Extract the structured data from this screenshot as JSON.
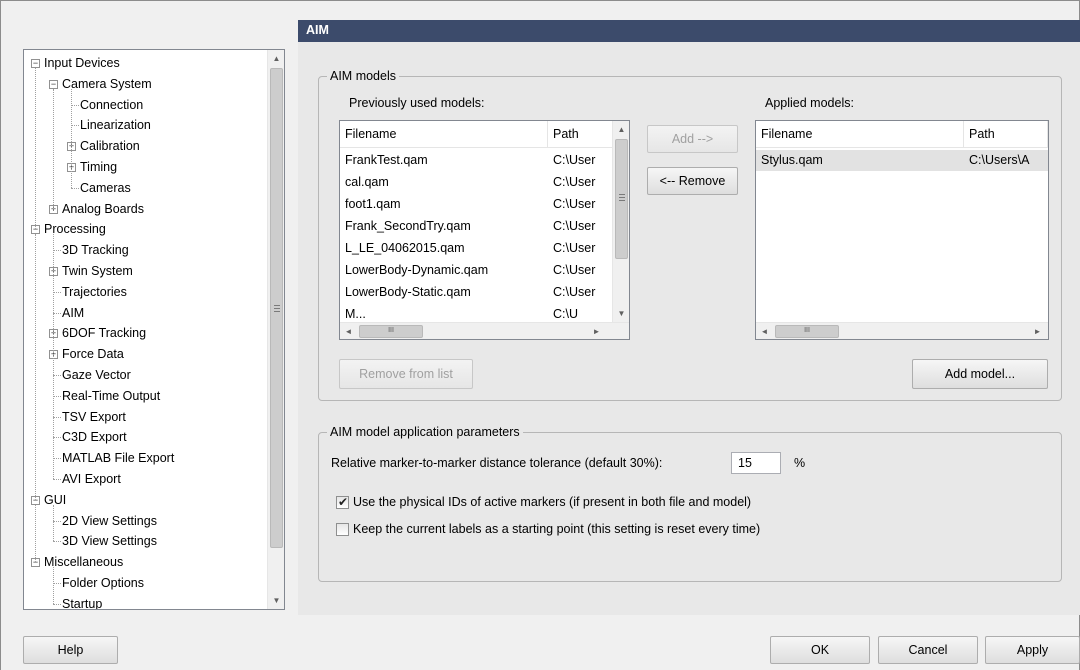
{
  "tree": {
    "items": [
      {
        "label": "Input Devices",
        "exp": "−"
      },
      {
        "label": "Camera System",
        "exp": "−"
      },
      {
        "label": "Connection",
        "exp": ""
      },
      {
        "label": "Linearization",
        "exp": ""
      },
      {
        "label": "Calibration",
        "exp": "+"
      },
      {
        "label": "Timing",
        "exp": "+"
      },
      {
        "label": "Cameras",
        "exp": ""
      },
      {
        "label": "Analog Boards",
        "exp": "+"
      },
      {
        "label": "Processing",
        "exp": "−"
      },
      {
        "label": "3D Tracking",
        "exp": ""
      },
      {
        "label": "Twin System",
        "exp": "+"
      },
      {
        "label": "Trajectories",
        "exp": ""
      },
      {
        "label": "AIM",
        "exp": ""
      },
      {
        "label": "6DOF Tracking",
        "exp": "+"
      },
      {
        "label": "Force Data",
        "exp": "+"
      },
      {
        "label": "Gaze Vector",
        "exp": ""
      },
      {
        "label": "Real-Time Output",
        "exp": ""
      },
      {
        "label": "TSV Export",
        "exp": ""
      },
      {
        "label": "C3D Export",
        "exp": ""
      },
      {
        "label": "MATLAB File Export",
        "exp": ""
      },
      {
        "label": "AVI Export",
        "exp": ""
      },
      {
        "label": "GUI",
        "exp": "−"
      },
      {
        "label": "2D View Settings",
        "exp": ""
      },
      {
        "label": "3D View Settings",
        "exp": ""
      },
      {
        "label": "Miscellaneous",
        "exp": "−"
      },
      {
        "label": "Folder Options",
        "exp": ""
      },
      {
        "label": "Startup",
        "exp": ""
      }
    ]
  },
  "page": {
    "title": "AIM"
  },
  "aim_models": {
    "group_title": "AIM models",
    "previous_label": "Previously used models:",
    "applied_label": "Applied models:",
    "col_filename": "Filename",
    "col_path": "Path",
    "previous_rows": [
      {
        "filename": "FrankTest.qam",
        "path": "C:\\User"
      },
      {
        "filename": "cal.qam",
        "path": "C:\\User"
      },
      {
        "filename": "foot1.qam",
        "path": "C:\\User"
      },
      {
        "filename": "Frank_SecondTry.qam",
        "path": "C:\\User"
      },
      {
        "filename": "L_LE_04062015.qam",
        "path": "C:\\User"
      },
      {
        "filename": "LowerBody-Dynamic.qam",
        "path": "C:\\User"
      },
      {
        "filename": "LowerBody-Static.qam",
        "path": "C:\\User"
      },
      {
        "filename": "M...",
        "path": "C:\\U"
      }
    ],
    "applied_rows": [
      {
        "filename": "Stylus.qam",
        "path": "C:\\Users\\A"
      }
    ],
    "add_button": "Add -->",
    "remove_button": "<-- Remove",
    "remove_from_list_button": "Remove from list",
    "add_model_button": "Add model...",
    "scroll_thumb_glyph": "III"
  },
  "params": {
    "group_title": "AIM model application parameters",
    "tolerance_label": "Relative marker-to-marker distance tolerance (default 30%):",
    "tolerance_value": "15",
    "tolerance_unit": "%",
    "use_ids_label": "Use the physical IDs of active markers (if present in both file and model)",
    "use_ids_checked": true,
    "keep_labels_label": "Keep the current labels as a starting point (this setting is reset every time)",
    "keep_labels_checked": false
  },
  "footer": {
    "help": "Help",
    "ok": "OK",
    "cancel": "Cancel",
    "apply": "Apply"
  },
  "colors": {
    "title_bar": "#3c4b6b",
    "content_bg": "#e8e8e8",
    "window_bg": "#f0f0f0"
  }
}
